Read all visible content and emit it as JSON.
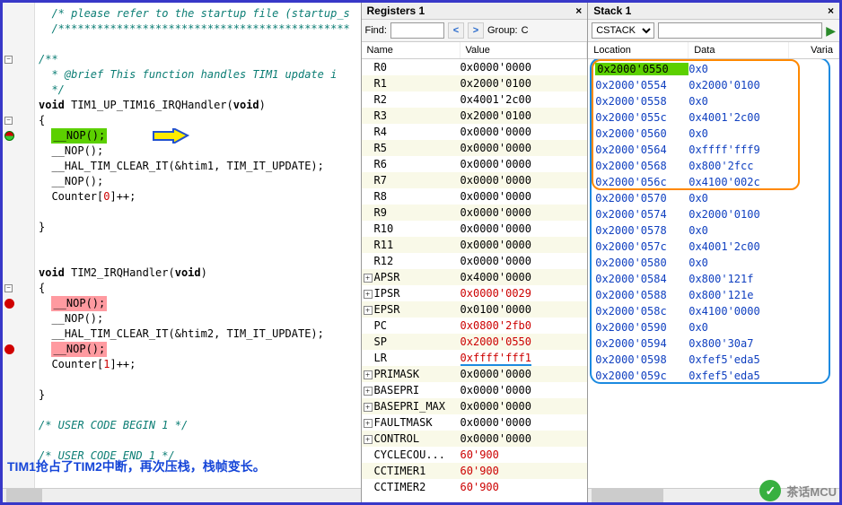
{
  "code": {
    "lines": [
      {
        "t": "comment",
        "text": "  /* please refer to the startup file (startup_s"
      },
      {
        "t": "comment",
        "text": "  /*********************************************"
      },
      {
        "t": "blank",
        "text": ""
      },
      {
        "t": "comment",
        "text": "/**"
      },
      {
        "t": "comment",
        "text": "  * @brief This function handles TIM1 update i"
      },
      {
        "t": "comment",
        "text": "  */"
      },
      {
        "t": "code",
        "text": "void TIM1_UP_TIM16_IRQHandler(void)"
      },
      {
        "t": "code",
        "text": "{"
      },
      {
        "t": "code",
        "text": "  ",
        "hl": "green",
        "hltext": "__NOP();",
        "arrow": true
      },
      {
        "t": "code",
        "text": "  __NOP();"
      },
      {
        "t": "code",
        "text": "  __HAL_TIM_CLEAR_IT(&htim1, TIM_IT_UPDATE);"
      },
      {
        "t": "code",
        "text": "  __NOP();"
      },
      {
        "t": "code",
        "text": "  Counter[0]++;"
      },
      {
        "t": "blank",
        "text": ""
      },
      {
        "t": "code",
        "text": "}"
      },
      {
        "t": "blank",
        "text": ""
      },
      {
        "t": "blank",
        "text": ""
      },
      {
        "t": "code",
        "text": "void TIM2_IRQHandler(void)"
      },
      {
        "t": "code",
        "text": "{"
      },
      {
        "t": "code",
        "text": "  ",
        "hl": "pink",
        "hltext": "__NOP();"
      },
      {
        "t": "code",
        "text": "  __NOP();"
      },
      {
        "t": "code",
        "text": "  __HAL_TIM_CLEAR_IT(&htim2, TIM_IT_UPDATE);"
      },
      {
        "t": "code",
        "text": "  ",
        "hl": "pink",
        "hltext": "__NOP();"
      },
      {
        "t": "code",
        "text": "  Counter[1]++;"
      },
      {
        "t": "blank",
        "text": ""
      },
      {
        "t": "code",
        "text": "}"
      },
      {
        "t": "blank",
        "text": ""
      },
      {
        "t": "comment",
        "text": "/* USER CODE BEGIN 1 */"
      },
      {
        "t": "blank",
        "text": ""
      },
      {
        "t": "comment",
        "text": "/* USER CODE END 1 */"
      }
    ],
    "num0": "0",
    "num1": "1"
  },
  "registers": {
    "title": "Registers 1",
    "find_label": "Find:",
    "group_label": "Group:",
    "group_value": "C",
    "col_name": "Name",
    "col_value": "Value",
    "rows": [
      {
        "n": "R0",
        "v": "0x0000'0000"
      },
      {
        "n": "R1",
        "v": "0x2000'0100"
      },
      {
        "n": "R2",
        "v": "0x4001'2c00"
      },
      {
        "n": "R3",
        "v": "0x2000'0100"
      },
      {
        "n": "R4",
        "v": "0x0000'0000"
      },
      {
        "n": "R5",
        "v": "0x0000'0000"
      },
      {
        "n": "R6",
        "v": "0x0000'0000"
      },
      {
        "n": "R7",
        "v": "0x0000'0000"
      },
      {
        "n": "R8",
        "v": "0x0000'0000"
      },
      {
        "n": "R9",
        "v": "0x0000'0000"
      },
      {
        "n": "R10",
        "v": "0x0000'0000"
      },
      {
        "n": "R11",
        "v": "0x0000'0000"
      },
      {
        "n": "R12",
        "v": "0x0000'0000"
      },
      {
        "n": "APSR",
        "v": "0x4000'0000",
        "exp": true
      },
      {
        "n": "IPSR",
        "v": "0x0000'0029",
        "exp": true,
        "red": true
      },
      {
        "n": "EPSR",
        "v": "0x0100'0000",
        "exp": true
      },
      {
        "n": "PC",
        "v": "0x0800'2fb0",
        "red": true
      },
      {
        "n": "SP",
        "v": "0x2000'0550",
        "red": true
      },
      {
        "n": "LR",
        "v": "0xffff'fff1",
        "red": true,
        "ul": true
      },
      {
        "n": "PRIMASK",
        "v": "0x0000'0000",
        "exp": true
      },
      {
        "n": "BASEPRI",
        "v": "0x0000'0000",
        "exp": true
      },
      {
        "n": "BASEPRI_MAX",
        "v": "0x0000'0000",
        "exp": true
      },
      {
        "n": "FAULTMASK",
        "v": "0x0000'0000",
        "exp": true
      },
      {
        "n": "CONTROL",
        "v": "0x0000'0000",
        "exp": true
      },
      {
        "n": "CYCLECOU...",
        "v": "60'900",
        "red": true
      },
      {
        "n": "CCTIMER1",
        "v": "60'900",
        "red": true
      },
      {
        "n": "CCTIMER2",
        "v": "60'900",
        "red": true
      }
    ]
  },
  "stack": {
    "title": "Stack 1",
    "select": "CSTACK",
    "col_loc": "Location",
    "col_data": "Data",
    "col_varia": "Varia",
    "rows": [
      {
        "l": "0x2000'0550",
        "d": "0x0",
        "hi": true
      },
      {
        "l": "0x2000'0554",
        "d": "0x2000'0100"
      },
      {
        "l": "0x2000'0558",
        "d": "0x0"
      },
      {
        "l": "0x2000'055c",
        "d": "0x4001'2c00"
      },
      {
        "l": "0x2000'0560",
        "d": "0x0"
      },
      {
        "l": "0x2000'0564",
        "d": "0xffff'fff9"
      },
      {
        "l": "0x2000'0568",
        "d": "0x800'2fcc"
      },
      {
        "l": "0x2000'056c",
        "d": "0x4100'002c"
      },
      {
        "l": "0x2000'0570",
        "d": "0x0"
      },
      {
        "l": "0x2000'0574",
        "d": "0x2000'0100"
      },
      {
        "l": "0x2000'0578",
        "d": "0x0"
      },
      {
        "l": "0x2000'057c",
        "d": "0x4001'2c00"
      },
      {
        "l": "0x2000'0580",
        "d": "0x0"
      },
      {
        "l": "0x2000'0584",
        "d": "0x800'121f"
      },
      {
        "l": "0x2000'0588",
        "d": "0x800'121e"
      },
      {
        "l": "0x2000'058c",
        "d": "0x4100'0000"
      },
      {
        "l": "0x2000'0590",
        "d": "0x0"
      },
      {
        "l": "0x2000'0594",
        "d": "0x800'30a7"
      },
      {
        "l": "0x2000'0598",
        "d": "0xfef5'eda5"
      },
      {
        "l": "0x2000'059c",
        "d": "0xfef5'eda5"
      }
    ],
    "annotation": "TIM1抢占了TIM2中断，再次压栈，栈帧变长。",
    "watermark": "茶话MCU"
  }
}
